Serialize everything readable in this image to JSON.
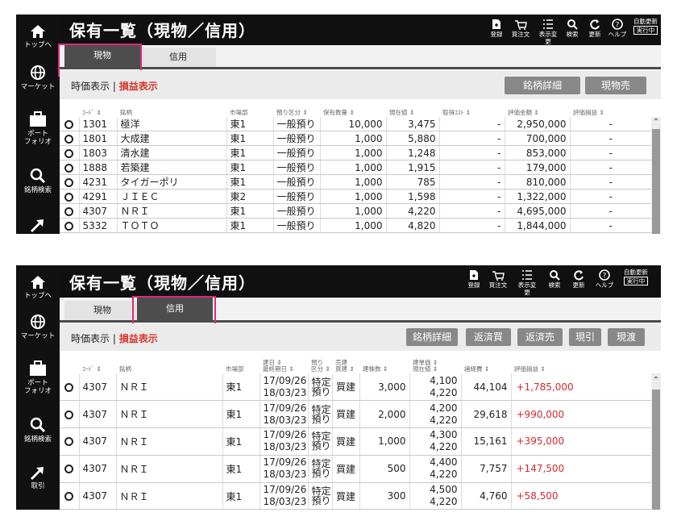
{
  "sidebar": {
    "top": "トップへ",
    "market": "マーケット",
    "portfolio_l1": "ポート",
    "portfolio_l2": "フォリオ",
    "search": "銘柄検索",
    "trade": "取引"
  },
  "header": {
    "title": "保有一覧（現物／信用）",
    "register": "登録",
    "buy_order": "買注文",
    "display_change": "表示変更",
    "search": "検索",
    "refresh": "更新",
    "help": "ヘルプ",
    "auto_update": "自動更新",
    "running": "実行中"
  },
  "tabs": {
    "genbutsu": "現物",
    "shinyo": "信用"
  },
  "mode": {
    "price": "時価表示",
    "sep": "|",
    "pl": "損益表示"
  },
  "panel1": {
    "buttons": {
      "detail": "銘柄詳細",
      "sell": "現物売"
    },
    "columns": [
      "ｺｰﾄﾞ ⇕",
      "銘柄",
      "市場部",
      "預り区分 ⇕",
      "保有数量 ⇕",
      "現在値 ⇕",
      "取得ｺｽﾄ ⇕",
      "評価金額 ⇕",
      "評価損益 ⇕"
    ],
    "rows": [
      {
        "code": "1301",
        "name": "極洋",
        "market": "東1",
        "custody": "一般預り",
        "qty": "10,000",
        "price": "3,475",
        "cost": "-",
        "value": "2,950,000",
        "pl": "-"
      },
      {
        "code": "1801",
        "name": "大成建",
        "market": "東1",
        "custody": "一般預り",
        "qty": "1,000",
        "price": "5,880",
        "cost": "-",
        "value": "700,000",
        "pl": "-"
      },
      {
        "code": "1803",
        "name": "清水建",
        "market": "東1",
        "custody": "一般預り",
        "qty": "1,000",
        "price": "1,248",
        "cost": "-",
        "value": "853,000",
        "pl": "-"
      },
      {
        "code": "1888",
        "name": "若築建",
        "market": "東1",
        "custody": "一般預り",
        "qty": "1,000",
        "price": "1,915",
        "cost": "-",
        "value": "179,000",
        "pl": "-"
      },
      {
        "code": "4231",
        "name": "タイガーポリ",
        "market": "東1",
        "custody": "一般預り",
        "qty": "1,000",
        "price": "785",
        "cost": "-",
        "value": "810,000",
        "pl": "-"
      },
      {
        "code": "4291",
        "name": "ＪＩＥＣ",
        "market": "東2",
        "custody": "一般預り",
        "qty": "1,000",
        "price": "1,598",
        "cost": "-",
        "value": "1,322,000",
        "pl": "-"
      },
      {
        "code": "4307",
        "name": "ＮＲＩ",
        "market": "東1",
        "custody": "一般預り",
        "qty": "1,000",
        "price": "4,220",
        "cost": "-",
        "value": "4,695,000",
        "pl": "-"
      },
      {
        "code": "5332",
        "name": "ＴＯＴＯ",
        "market": "東1",
        "custody": "一般預り",
        "qty": "1,000",
        "price": "4,820",
        "cost": "-",
        "value": "1,844,000",
        "pl": "-"
      }
    ]
  },
  "panel2": {
    "buttons": {
      "detail": "銘柄詳細",
      "repay_buy": "返済買",
      "repay_sell": "返済売",
      "genbiki": "現引",
      "genwatashi": "現渡"
    },
    "columns": {
      "code": "ｺｰﾄﾞ ⇕",
      "name": "銘柄",
      "market": "市場部",
      "date_1": "建日 ⇕",
      "date_2": "最終期日 ⇕",
      "custody_1": "預り",
      "custody_2": "区分 ⇕",
      "side_1": "売建",
      "side_2": "買建 ⇕",
      "qty": "建株数 ⇕",
      "price_1": "建単価 ⇕",
      "price_2": "現在値 ⇕",
      "fee": "諸経費 ⇕",
      "pl": "評価損益 ⇕"
    },
    "rows": [
      {
        "code": "4307",
        "name": "ＮＲＩ",
        "market": "東1",
        "open_date": "17/09/26",
        "due_date": "18/03/23",
        "custody_1": "特定",
        "custody_2": "預り",
        "side": "買建",
        "qty": "3,000",
        "open_price": "4,100",
        "cur_price": "4,220",
        "fee": "44,104",
        "pl": "+1,785,000"
      },
      {
        "code": "4307",
        "name": "ＮＲＩ",
        "market": "東1",
        "open_date": "17/09/26",
        "due_date": "18/03/23",
        "custody_1": "特定",
        "custody_2": "預り",
        "side": "買建",
        "qty": "2,000",
        "open_price": "4,200",
        "cur_price": "4,220",
        "fee": "29,618",
        "pl": "+990,000"
      },
      {
        "code": "4307",
        "name": "ＮＲＩ",
        "market": "東1",
        "open_date": "17/09/26",
        "due_date": "18/03/23",
        "custody_1": "特定",
        "custody_2": "預り",
        "side": "買建",
        "qty": "1,000",
        "open_price": "4,300",
        "cur_price": "4,220",
        "fee": "15,161",
        "pl": "+395,000"
      },
      {
        "code": "4307",
        "name": "ＮＲＩ",
        "market": "東1",
        "open_date": "17/09/26",
        "due_date": "18/03/23",
        "custody_1": "特定",
        "custody_2": "預り",
        "side": "買建",
        "qty": "500",
        "open_price": "4,400",
        "cur_price": "4,220",
        "fee": "7,757",
        "pl": "+147,500"
      },
      {
        "code": "4307",
        "name": "ＮＲＩ",
        "market": "東1",
        "open_date": "17/09/26",
        "due_date": "18/03/23",
        "custody_1": "特定",
        "custody_2": "預り",
        "side": "買建",
        "qty": "300",
        "open_price": "4,500",
        "cur_price": "4,220",
        "fee": "4,760",
        "pl": "+58,500"
      }
    ]
  },
  "colors": {
    "accent_red": "#d42b2b",
    "highlight": "#e0287a",
    "header_bg": "#101010",
    "button_bg": "#888888"
  }
}
